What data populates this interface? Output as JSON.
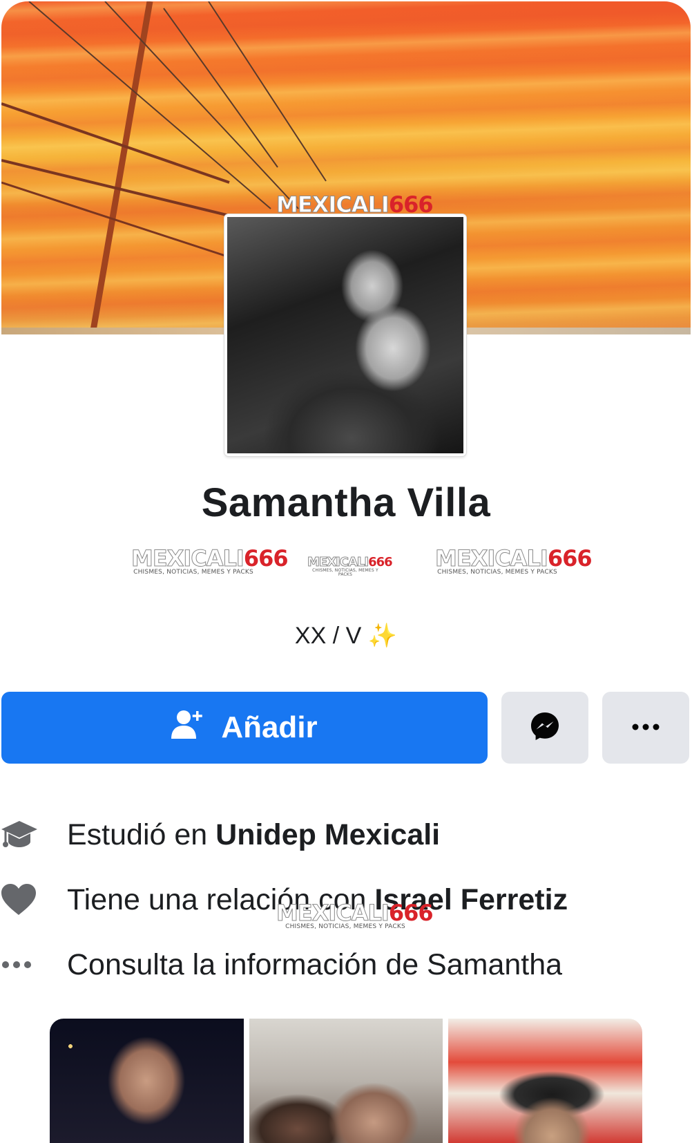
{
  "profile": {
    "name": "Samantha Villa",
    "bio_text": "XX / V",
    "bio_emoji": "✨"
  },
  "watermark": {
    "brand_part1": "MEXICALI",
    "brand_part2": "666",
    "tagline": "CHISMES, NOTICIAS, MEMES Y PACKS"
  },
  "actions": {
    "add_label": "Añadir",
    "add_icon": "add-friend-icon",
    "messenger_icon": "messenger-icon",
    "more_icon": "more-icon"
  },
  "details": [
    {
      "icon": "graduation-cap-icon",
      "prefix": "Estudió en ",
      "bold": "Unidep Mexicali"
    },
    {
      "icon": "heart-icon",
      "prefix": "Tiene una relación con ",
      "bold": "Israel Ferretiz"
    },
    {
      "icon": "ellipsis-icon",
      "prefix": "Consulta la información de Samantha",
      "bold": ""
    }
  ],
  "colors": {
    "primary": "#1877f2",
    "secondary_button": "#e4e6eb",
    "text": "#1c1e21",
    "icon_gray": "#65676b",
    "watermark_red": "#d9232a"
  }
}
